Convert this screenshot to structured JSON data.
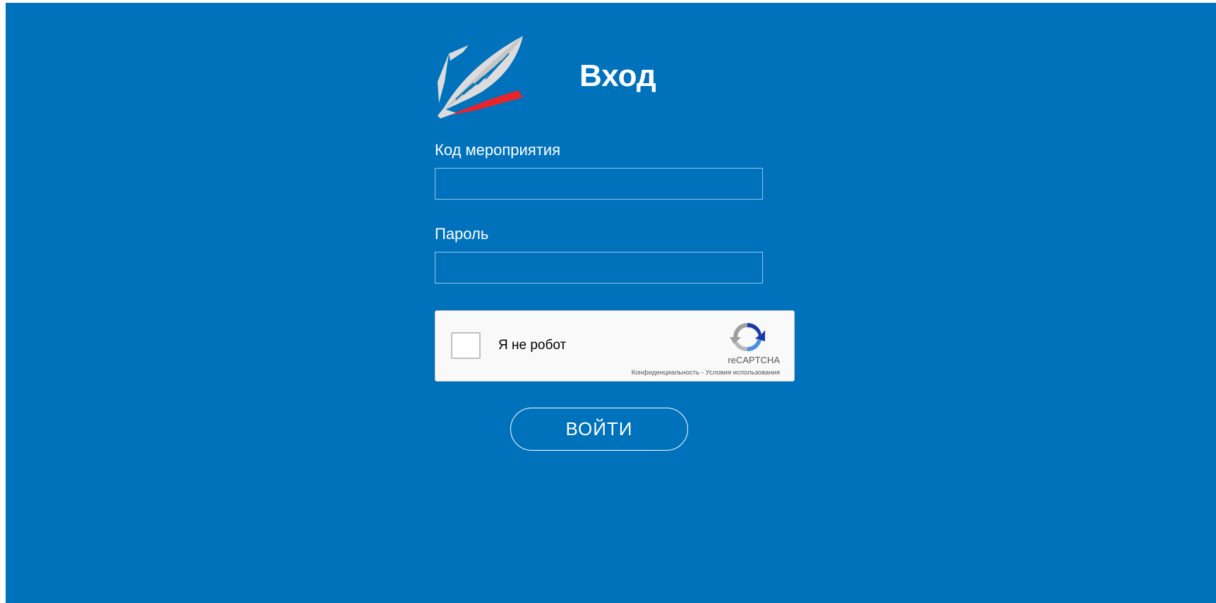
{
  "header": {
    "title": "Вход",
    "logo_icon": "feather-quill-logo"
  },
  "form": {
    "event_code_label": "Код мероприятия",
    "event_code_value": "",
    "password_label": "Пароль",
    "password_value": ""
  },
  "captcha": {
    "checkbox_label": "Я не робот",
    "checked": false,
    "brand": "reCAPTCHA",
    "privacy_link": "Конфиденциальность",
    "separator": " - ",
    "terms_link": "Условия использования"
  },
  "submit_label": "ВОЙТИ",
  "colors": {
    "background": "#0072bc",
    "text": "#ffffff",
    "accent_red": "#e8232a",
    "logo_gray": "#d9d9d9"
  }
}
